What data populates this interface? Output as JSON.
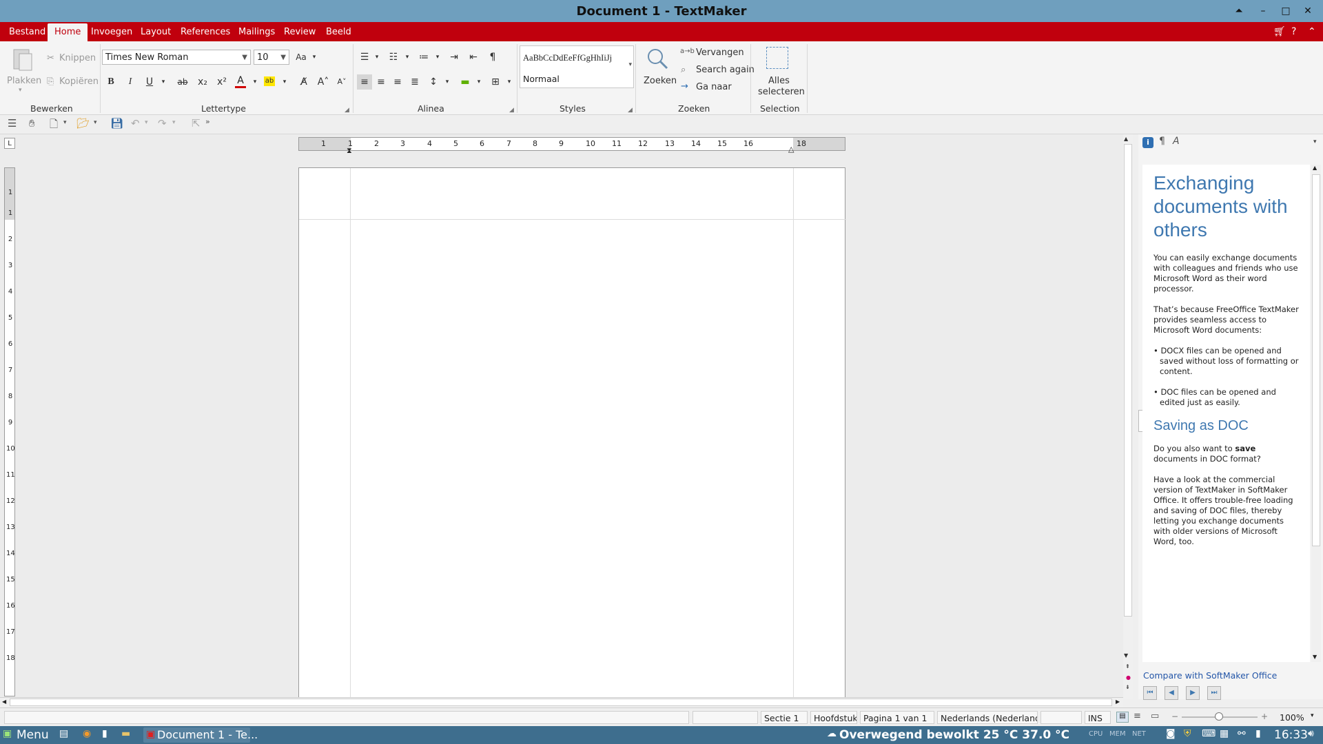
{
  "window": {
    "title": "Document 1 - TextMaker"
  },
  "menu": {
    "tabs": [
      "Bestand",
      "Home",
      "Invoegen",
      "Layout",
      "References",
      "Mailings",
      "Review",
      "Beeld"
    ],
    "active": "Home"
  },
  "ribbon": {
    "bewerken": {
      "paste": "Plakken",
      "cut": "Knippen",
      "copy": "Kopiëren",
      "label": "Bewerken"
    },
    "lettertype": {
      "font": "Times New Roman",
      "size": "10",
      "label": "Lettertype",
      "bold": "B",
      "italic": "I",
      "underline": "U",
      "strike": "ab",
      "sub": "x₂",
      "sup": "x²"
    },
    "alinea": {
      "label": "Alinea",
      "pilcrow": "¶"
    },
    "styles": {
      "preview": "AaBbCcDdEeFfGgHhIiJj",
      "current": "Normaal",
      "label": "Styles"
    },
    "zoeken": {
      "search": "Zoeken",
      "replace": "Vervangen",
      "again": "Search again",
      "goto": "Ga naar",
      "label": "Zoeken"
    },
    "selection": {
      "select_all_1": "Alles",
      "select_all_2": "selecteren",
      "label": "Selection"
    }
  },
  "ruler": {
    "h_numbers": [
      "1",
      "1",
      "2",
      "3",
      "4",
      "5",
      "6",
      "7",
      "8",
      "9",
      "10",
      "11",
      "12",
      "13",
      "14",
      "15",
      "16",
      "18"
    ],
    "v_numbers": [
      "1",
      "1",
      "2",
      "3",
      "4",
      "5",
      "6",
      "7",
      "8",
      "9",
      "10",
      "11",
      "12",
      "13",
      "14",
      "15",
      "16",
      "17",
      "18"
    ]
  },
  "sidebar": {
    "heading1": "Exchanging documents with others",
    "p1": "You can easily exchange documents with colleagues and friends who use Microsoft Word as their word processor.",
    "p2": "That’s because FreeOffice TextMaker provides seamless access to Microsoft Word documents:",
    "bullet1": "• DOCX files can be opened and saved without loss of formatting or content.",
    "bullet2": "• DOC files can be opened and edited just as easily.",
    "heading2": "Saving as DOC",
    "p3_pre": "Do you also want to ",
    "p3_bold": "save",
    "p3_post": " documents in DOC format?",
    "p4": "Have a look at the commercial version of TextMaker in SoftMaker Office. It offers trouble-free loading and saving of DOC files, thereby letting you exchange documents with older versions of Microsoft Word, too.",
    "compare_link": "Compare with SoftMaker Office"
  },
  "status": {
    "section": "Sectie 1",
    "chapter": "Hoofdstuk",
    "page": "Pagina 1 van 1",
    "language": "Nederlands (Nederland",
    "mode": "INS",
    "zoom": "100%"
  },
  "taskbar": {
    "menu": "Menu",
    "task": "Document 1 - Te...",
    "weather": "Overwegend bewolkt 25 °C 37.0 °C",
    "clock": "16:33"
  },
  "colors": {
    "titlebar": "#6f9fbe",
    "menubar": "#c0000d",
    "accent_blue": "#3f78b0",
    "taskbar": "#3e6e8e"
  }
}
